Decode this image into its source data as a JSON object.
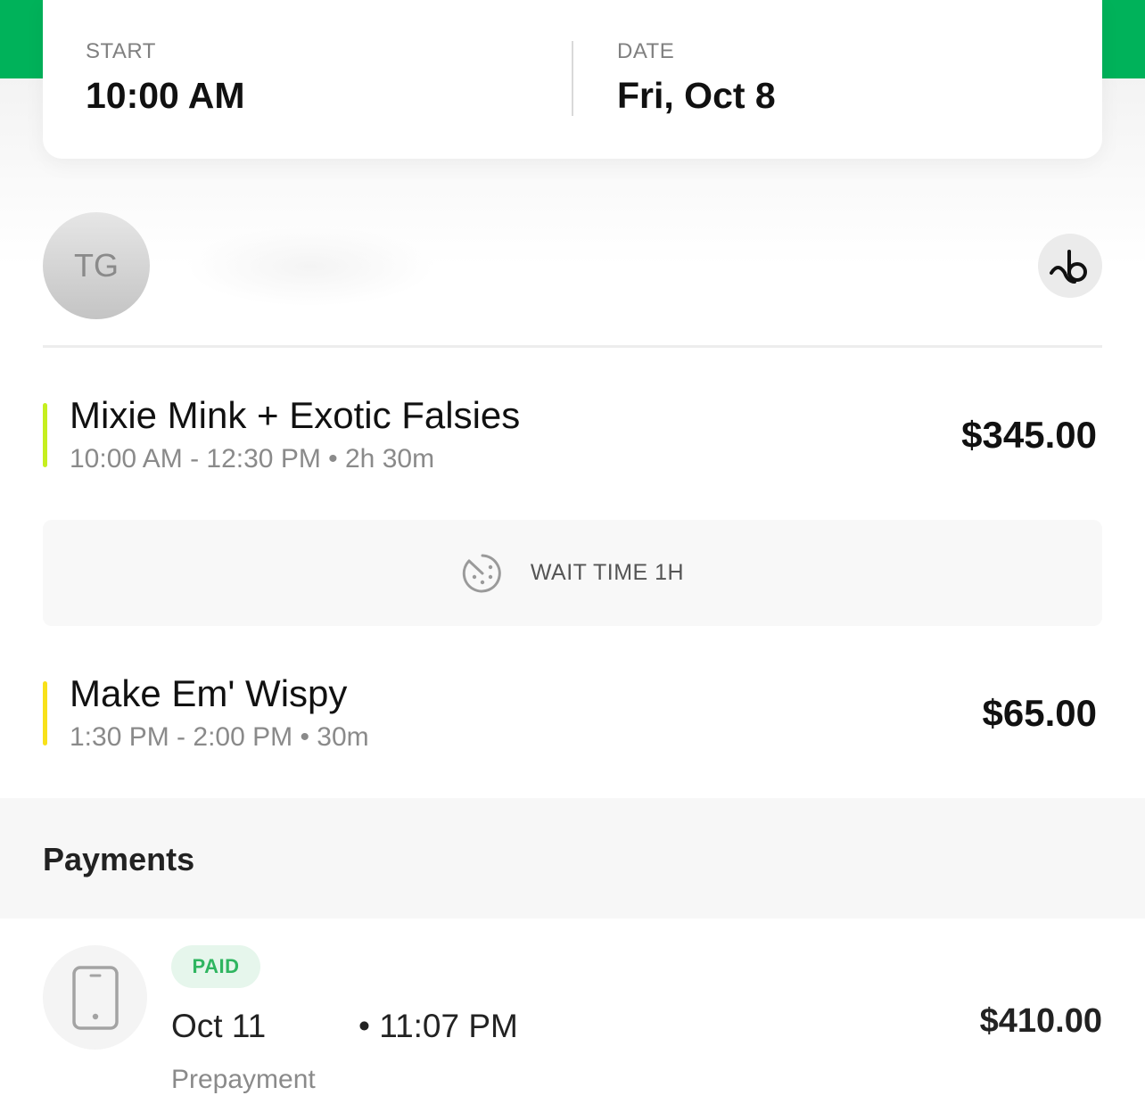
{
  "colors": {
    "brand_green": "#00b25a",
    "service1_bar": "#c6ef1f",
    "service2_bar": "#f8e11a",
    "paid_green": "#2fb560"
  },
  "appointment": {
    "start_label": "START",
    "start_value": "10:00 AM",
    "date_label": "DATE",
    "date_value": "Fri, Oct 8"
  },
  "client": {
    "initials": "TG",
    "name_blurred": true,
    "brand_icon": "booksy-logo-icon"
  },
  "services": [
    {
      "name": "Mixie Mink + Exotic Falsies",
      "time": "10:00 AM - 12:30 PM • 2h 30m",
      "price": "$345.00"
    },
    {
      "name": "Make Em' Wispy",
      "time": "1:30 PM - 2:00 PM • 30m",
      "price": "$65.00"
    }
  ],
  "wait": {
    "icon": "wait-clock-icon",
    "label": "WAIT TIME 1H"
  },
  "payments": {
    "title": "Payments",
    "items": [
      {
        "icon": "phone-icon",
        "status": "PAID",
        "date": "Oct 11",
        "time": "• 11:07 PM",
        "amount": "$410.00",
        "type": "Prepayment"
      }
    ]
  }
}
